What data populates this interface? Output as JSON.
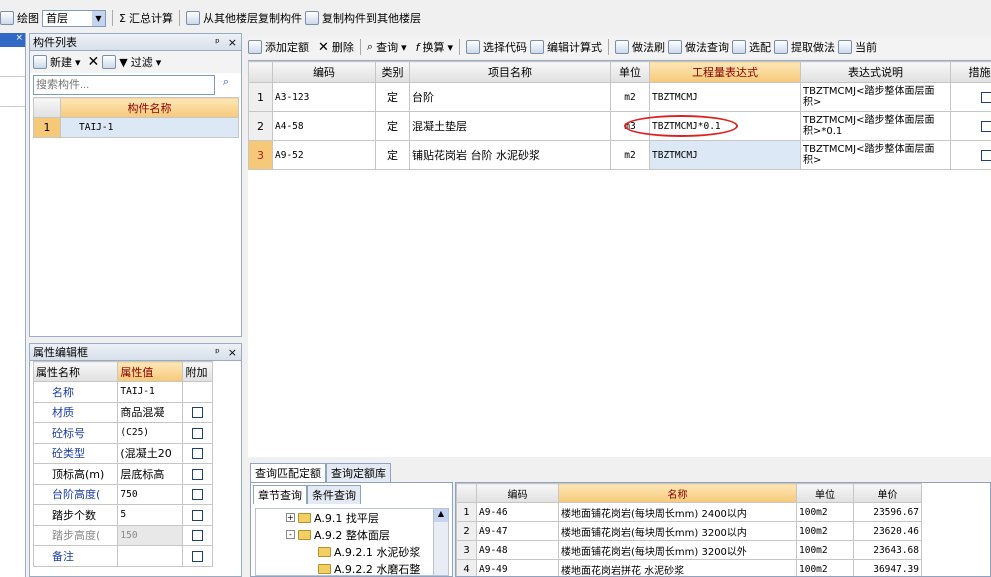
{
  "toolbar": {
    "draw": "绘图",
    "floor": "首层",
    "sum": "汇总计算",
    "copy_from": "从其他楼层复制构件",
    "copy_to": "复制构件到其他楼层"
  },
  "comp_list": {
    "title": "构件列表",
    "new": "新建",
    "filter": "过滤",
    "search_ph": "搜索构件...",
    "col_name": "构件名称",
    "rows": [
      {
        "n": "1",
        "name": "TAIJ-1"
      }
    ]
  },
  "prop_edit": {
    "title": "属性编辑框",
    "col_name": "属性名称",
    "col_val": "属性值",
    "col_add": "附加",
    "rows": [
      {
        "name": "名称",
        "val": "TAIJ-1",
        "chk": false,
        "has_chk": false
      },
      {
        "name": "材质",
        "val": "商品混凝",
        "chk": false,
        "has_chk": true
      },
      {
        "name": "砼标号",
        "val": "(C25)",
        "chk": false,
        "has_chk": true
      },
      {
        "name": "砼类型",
        "val": "(混凝土20",
        "chk": false,
        "has_chk": true
      },
      {
        "name": "顶标高(m)",
        "val": "层底标高",
        "chk": false,
        "has_chk": true
      },
      {
        "name": "台阶高度(",
        "val": "750",
        "chk": false,
        "has_chk": true
      },
      {
        "name": "踏步个数",
        "val": "5",
        "chk": false,
        "has_chk": true
      },
      {
        "name": "踏步高度(",
        "val": "150",
        "chk": false,
        "has_chk": true
      },
      {
        "name": "备注",
        "val": "",
        "chk": false,
        "has_chk": true
      }
    ]
  },
  "quota_toolbar": {
    "add": "添加定额",
    "del": "删除",
    "query": "查询",
    "calc": "换算",
    "select_code": "选择代码",
    "edit_formula": "编辑计算式",
    "method_brush": "做法刷",
    "method_query": "做法查询",
    "match": "选配",
    "extract": "提取做法",
    "current": "当前"
  },
  "quota_table": {
    "headers": [
      "编码",
      "类别",
      "项目名称",
      "单位",
      "工程量表达式",
      "表达式说明",
      "措施"
    ],
    "rows": [
      {
        "n": "1",
        "code": "A3-123",
        "type": "定",
        "name": "台阶",
        "unit": "m2",
        "expr": "TBZTMCMJ",
        "desc1": "TBZTMCMJ<踏步整体面层面",
        "desc2": "积>"
      },
      {
        "n": "2",
        "code": "A4-58",
        "type": "定",
        "name": "混凝土垫层",
        "unit": "m3",
        "expr": "TBZTMCMJ*0.1",
        "desc1": "TBZTMCMJ<踏步整体面层面",
        "desc2": "积>*0.1"
      },
      {
        "n": "3",
        "code": "A9-52",
        "type": "定",
        "name": "铺贴花岗岩 台阶 水泥砂浆",
        "unit": "m2",
        "expr": "TBZTMCMJ",
        "desc1": "TBZTMCMJ<踏步整体面层面",
        "desc2": "积>"
      }
    ]
  },
  "bottom": {
    "tab1": "查询匹配定额",
    "tab2": "查询定额库",
    "subtab1": "章节查询",
    "subtab2": "条件查询",
    "tree": [
      {
        "label": "A.9.1 找平层",
        "indent": 0,
        "exp": "+"
      },
      {
        "label": "A.9.2 整体面层",
        "indent": 0,
        "exp": "-"
      },
      {
        "label": "A.9.2.1 水泥砂浆",
        "indent": 1,
        "exp": ""
      },
      {
        "label": "A.9.2.2 水磨石整",
        "indent": 1,
        "exp": ""
      }
    ],
    "headers": [
      "编码",
      "名称",
      "单位",
      "单价"
    ],
    "rows": [
      {
        "n": "1",
        "code": "A9-46",
        "name": "楼地面铺花岗岩(每块周长mm) 2400以内",
        "unit": "100m2",
        "price": "23596.67"
      },
      {
        "n": "2",
        "code": "A9-47",
        "name": "楼地面铺花岗岩(每块周长mm) 3200以内",
        "unit": "100m2",
        "price": "23620.46"
      },
      {
        "n": "3",
        "code": "A9-48",
        "name": "楼地面铺花岗岩(每块周长mm) 3200以外",
        "unit": "100m2",
        "price": "23643.68"
      },
      {
        "n": "4",
        "code": "A9-49",
        "name": "楼地面花岗岩拼花 水泥砂浆",
        "unit": "100m2",
        "price": "36947.39"
      }
    ]
  }
}
